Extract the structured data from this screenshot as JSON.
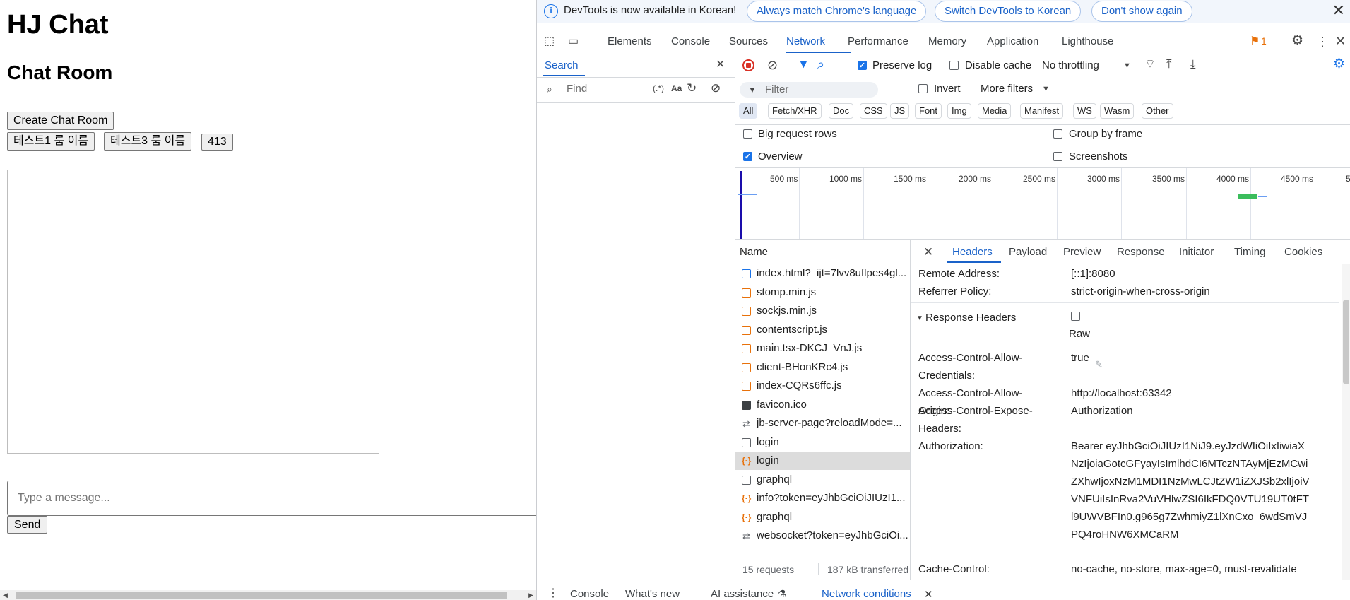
{
  "page": {
    "title": "HJ Chat",
    "subtitle": "Chat Room",
    "create_room_button": "Create Chat Room",
    "room_buttons": [
      "테스트1 룸 이름",
      "테스트3 룸 이름",
      "413"
    ],
    "message_placeholder": "Type a message...",
    "send_button": "Send"
  },
  "devtools": {
    "infobar": {
      "text": "DevTools is now available in Korean!",
      "buttons": [
        "Always match Chrome's language",
        "Switch DevTools to Korean",
        "Don't show again"
      ]
    },
    "main_tabs": [
      "Elements",
      "Console",
      "Sources",
      "Network",
      "Performance",
      "Memory",
      "Application",
      "Lighthouse"
    ],
    "active_main_tab": "Network",
    "issues_count": "1",
    "search_panel": {
      "tab": "Search",
      "find_placeholder": "Find",
      "regex_label": "(.*)",
      "case_label": "Aa"
    },
    "network_toolbar": {
      "preserve_log": "Preserve log",
      "disable_cache": "Disable cache",
      "throttling": "No throttling",
      "filter_placeholder": "Filter",
      "invert": "Invert",
      "more_filters": "More filters",
      "type_filters": [
        "All",
        "Fetch/XHR",
        "Doc",
        "CSS",
        "JS",
        "Font",
        "Img",
        "Media",
        "Manifest",
        "WS",
        "Wasm",
        "Other"
      ],
      "big_request_rows": "Big request rows",
      "group_by_frame": "Group by frame",
      "overview": "Overview",
      "screenshots": "Screenshots"
    },
    "timeline_ticks": [
      "500 ms",
      "1000 ms",
      "1500 ms",
      "2000 ms",
      "2500 ms",
      "3000 ms",
      "3500 ms",
      "4000 ms",
      "4500 ms",
      "5"
    ],
    "request_list": {
      "header": "Name",
      "items": [
        {
          "name": "index.html?_ijt=7lvv8uflpes4gl...",
          "kind": "doc"
        },
        {
          "name": "stomp.min.js",
          "kind": "js"
        },
        {
          "name": "sockjs.min.js",
          "kind": "js"
        },
        {
          "name": "contentscript.js",
          "kind": "js"
        },
        {
          "name": "main.tsx-DKCJ_VnJ.js",
          "kind": "js"
        },
        {
          "name": "client-BHonKRc4.js",
          "kind": "js"
        },
        {
          "name": "index-CQRs6ffc.js",
          "kind": "js"
        },
        {
          "name": "favicon.ico",
          "kind": "ico"
        },
        {
          "name": "jb-server-page?reloadMode=...",
          "kind": "ws"
        },
        {
          "name": "login",
          "kind": "blank"
        },
        {
          "name": "login",
          "kind": "xhr"
        },
        {
          "name": "graphql",
          "kind": "blank"
        },
        {
          "name": "info?token=eyJhbGciOiJIUzI1...",
          "kind": "xhr"
        },
        {
          "name": "graphql",
          "kind": "xhr"
        },
        {
          "name": "websocket?token=eyJhbGciOi...",
          "kind": "ws"
        }
      ],
      "summary_requests": "15 requests",
      "summary_transferred": "187 kB transferred"
    },
    "detail_tabs": [
      "Headers",
      "Payload",
      "Preview",
      "Response",
      "Initiator",
      "Timing",
      "Cookies"
    ],
    "active_detail_tab": "Headers",
    "headers": {
      "general": [
        {
          "key": "Remote Address:",
          "value": "[::1]:8080"
        },
        {
          "key": "Referrer Policy:",
          "value": "strict-origin-when-cross-origin"
        }
      ],
      "response_section": "Response Headers",
      "raw_label": "Raw",
      "response": [
        {
          "key": "Access-Control-Allow-Credentials:",
          "value": "true"
        },
        {
          "key": "Access-Control-Allow-Origin:",
          "value": "http://localhost:63342"
        },
        {
          "key": "Access-Control-Expose-Headers:",
          "value": "Authorization"
        },
        {
          "key": "Authorization:",
          "value": "Bearer eyJhbGciOiJIUzI1NiJ9.eyJzdWIiOiIxIiwiaXNzIjoiaGotcGFyayIsImlhdCI6MTczNTAyMjEzMCwiZXhwIjoxNzM1MDI1NzMwLCJtZW1iZXJSb2xlIjoiVVNFUiIsInRva2VuVHlwZSI6IkFDQ0VTU19UT0tFTl9UWVBFIn0.g965g7ZwhmiyZ1lXnCxo_6wdSmVJPQ4roHNW6XMCaRM"
        },
        {
          "key": "Cache-Control:",
          "value": "no-cache, no-store, max-age=0, must-revalidate"
        }
      ]
    },
    "drawer_tabs": [
      "Console",
      "What's new",
      "AI assistance",
      "Network conditions"
    ],
    "active_drawer_tab": "Network conditions"
  }
}
